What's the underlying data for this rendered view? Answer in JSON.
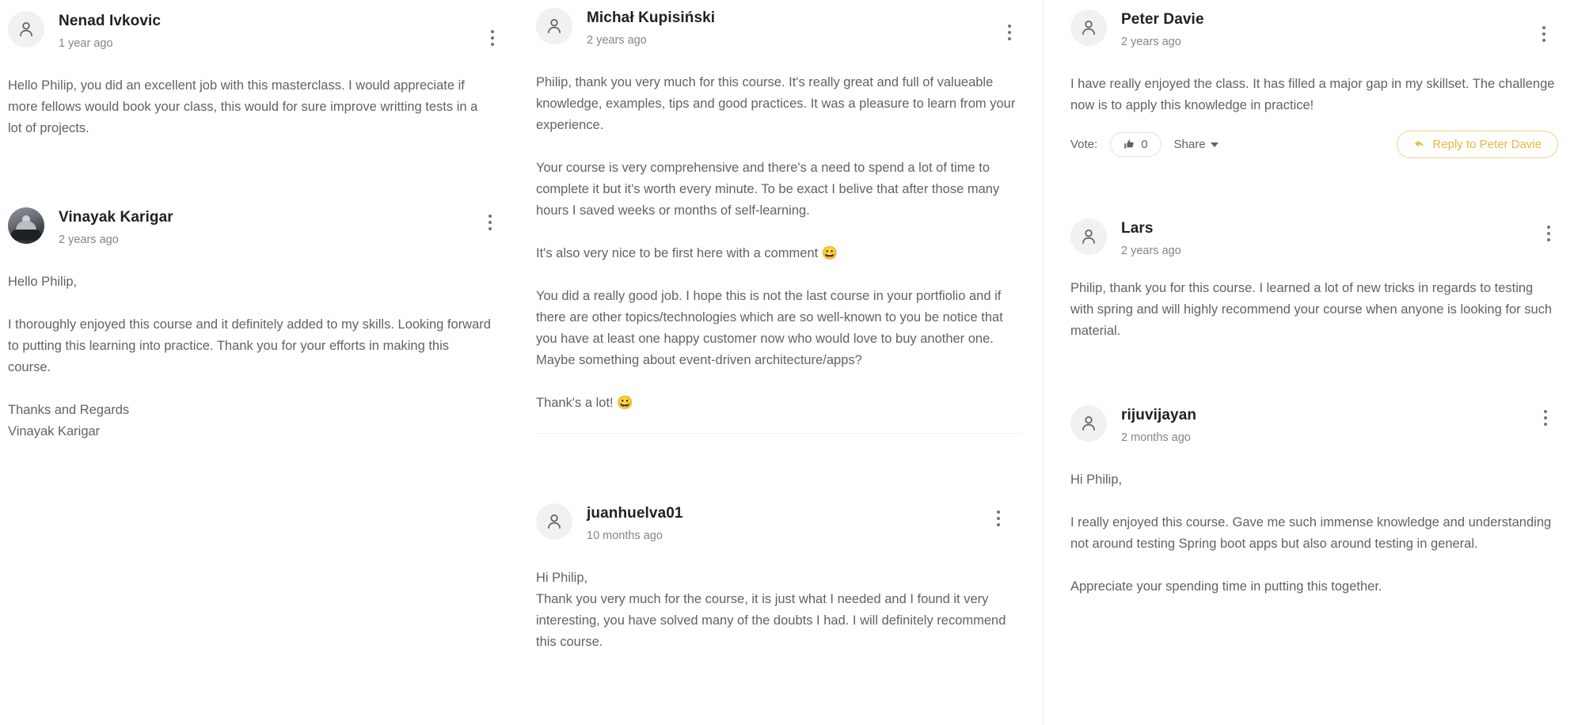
{
  "theme": {
    "text_color": "#5f6368",
    "name_color": "#202124",
    "meta_color": "#80868b",
    "accent_yellow": "#e8b93a",
    "divider_color": "#ececec",
    "avatar_bg": "#f1f1f1"
  },
  "icons": {
    "kebab": "more-vertical-icon",
    "person": "person-avatar-icon",
    "thumbs_up": "thumbs-up-icon",
    "caret": "chevron-down-icon",
    "reply_arrow": "reply-arrow-icon"
  },
  "columns": [
    {
      "id": "left",
      "comments": [
        {
          "name": "Nenad Ivkovic",
          "time": "1 year ago",
          "avatar": "default",
          "paragraphs": [
            "Hello Philip, you did an excellent job with this masterclass. I would appreciate if more fellows would book your class, this would for sure improve writting tests in a lot of projects."
          ]
        },
        {
          "name": "Vinayak Karigar",
          "time": "2 years ago",
          "avatar": "photo",
          "paragraphs": [
            "Hello Philip,",
            "I thoroughly enjoyed this course and it definitely added to my skills. Looking forward to putting this learning into practice. Thank you for your efforts in making this course.",
            "Thanks and Regards",
            "Vinayak Karigar"
          ]
        }
      ]
    },
    {
      "id": "middle",
      "comments": [
        {
          "name": "Michał Kupisiński",
          "time": "2 years ago",
          "avatar": "default",
          "paragraphs": [
            "Philip, thank you very much for this course. It's really great and full of valueable knowledge, examples, tips and good practices. It was a pleasure to learn from your experience.",
            "Your course is very comprehensive and there's a need to spend a lot of time to complete it but it's worth every minute. To be exact I belive that after those many hours I saved weeks or months of self-learning.",
            "It's also very nice to be first here with a comment 😀",
            "You did a really good job. I hope this is not the last course in your portfiolio and if there are other topics/technologies which are so well-known to you be notice that you have at least one happy customer now who would love to buy another one. Maybe something about event-driven architecture/apps?",
            "Thank's a lot! 😀"
          ]
        },
        {
          "name": "juanhuelva01",
          "time": "10 months ago",
          "avatar": "default",
          "paragraphs": [
            "Hi Philip,",
            "Thank you very much for the course, it is just what I needed and I found it very interesting, you have solved many of the doubts I had. I will definitely recommend this course."
          ]
        }
      ]
    },
    {
      "id": "right",
      "comments": [
        {
          "name": "Peter Davie",
          "time": "2 years ago",
          "avatar": "default",
          "paragraphs": [
            "I have really enjoyed the class. It has filled a major gap in my skillset. The challenge now is to apply this knowledge in practice!"
          ],
          "actions": {
            "vote_label": "Vote:",
            "vote_count": "0",
            "share_label": "Share",
            "reply_label": "Reply to Peter Davie"
          }
        },
        {
          "name": "Lars",
          "time": "2 years ago",
          "avatar": "default",
          "paragraphs": [
            "Philip, thank you for this course. I learned a lot of new tricks in regards to testing with spring and will highly recommend your course when anyone is looking for such material."
          ]
        },
        {
          "name": "rijuvijayan",
          "time": "2 months ago",
          "avatar": "default",
          "paragraphs": [
            "Hi Philip,",
            "I really enjoyed this course. Gave me such immense knowledge and understanding not around testing Spring boot apps but also around testing in general.",
            "Appreciate your spending time in putting this together."
          ]
        }
      ]
    }
  ]
}
